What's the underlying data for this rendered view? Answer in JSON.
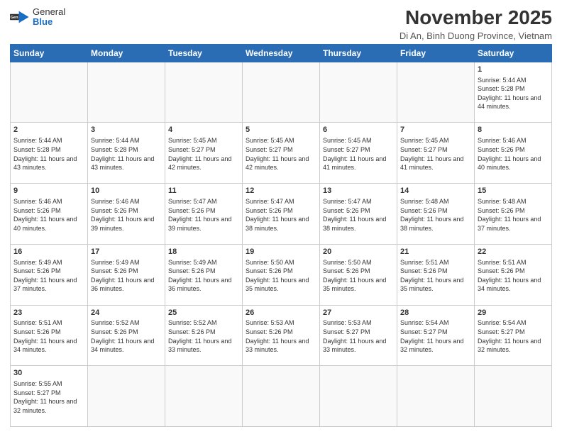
{
  "logo": {
    "general": "General",
    "blue": "Blue"
  },
  "header": {
    "month_title": "November 2025",
    "subtitle": "Di An, Binh Duong Province, Vietnam"
  },
  "weekdays": [
    "Sunday",
    "Monday",
    "Tuesday",
    "Wednesday",
    "Thursday",
    "Friday",
    "Saturday"
  ],
  "weeks": [
    [
      {
        "day": "",
        "content": ""
      },
      {
        "day": "",
        "content": ""
      },
      {
        "day": "",
        "content": ""
      },
      {
        "day": "",
        "content": ""
      },
      {
        "day": "",
        "content": ""
      },
      {
        "day": "",
        "content": ""
      },
      {
        "day": "1",
        "content": "Sunrise: 5:44 AM\nSunset: 5:28 PM\nDaylight: 11 hours and 44 minutes."
      }
    ],
    [
      {
        "day": "2",
        "content": "Sunrise: 5:44 AM\nSunset: 5:28 PM\nDaylight: 11 hours and 43 minutes."
      },
      {
        "day": "3",
        "content": "Sunrise: 5:44 AM\nSunset: 5:28 PM\nDaylight: 11 hours and 43 minutes."
      },
      {
        "day": "4",
        "content": "Sunrise: 5:45 AM\nSunset: 5:27 PM\nDaylight: 11 hours and 42 minutes."
      },
      {
        "day": "5",
        "content": "Sunrise: 5:45 AM\nSunset: 5:27 PM\nDaylight: 11 hours and 42 minutes."
      },
      {
        "day": "6",
        "content": "Sunrise: 5:45 AM\nSunset: 5:27 PM\nDaylight: 11 hours and 41 minutes."
      },
      {
        "day": "7",
        "content": "Sunrise: 5:45 AM\nSunset: 5:27 PM\nDaylight: 11 hours and 41 minutes."
      },
      {
        "day": "8",
        "content": "Sunrise: 5:46 AM\nSunset: 5:26 PM\nDaylight: 11 hours and 40 minutes."
      }
    ],
    [
      {
        "day": "9",
        "content": "Sunrise: 5:46 AM\nSunset: 5:26 PM\nDaylight: 11 hours and 40 minutes."
      },
      {
        "day": "10",
        "content": "Sunrise: 5:46 AM\nSunset: 5:26 PM\nDaylight: 11 hours and 39 minutes."
      },
      {
        "day": "11",
        "content": "Sunrise: 5:47 AM\nSunset: 5:26 PM\nDaylight: 11 hours and 39 minutes."
      },
      {
        "day": "12",
        "content": "Sunrise: 5:47 AM\nSunset: 5:26 PM\nDaylight: 11 hours and 38 minutes."
      },
      {
        "day": "13",
        "content": "Sunrise: 5:47 AM\nSunset: 5:26 PM\nDaylight: 11 hours and 38 minutes."
      },
      {
        "day": "14",
        "content": "Sunrise: 5:48 AM\nSunset: 5:26 PM\nDaylight: 11 hours and 38 minutes."
      },
      {
        "day": "15",
        "content": "Sunrise: 5:48 AM\nSunset: 5:26 PM\nDaylight: 11 hours and 37 minutes."
      }
    ],
    [
      {
        "day": "16",
        "content": "Sunrise: 5:49 AM\nSunset: 5:26 PM\nDaylight: 11 hours and 37 minutes."
      },
      {
        "day": "17",
        "content": "Sunrise: 5:49 AM\nSunset: 5:26 PM\nDaylight: 11 hours and 36 minutes."
      },
      {
        "day": "18",
        "content": "Sunrise: 5:49 AM\nSunset: 5:26 PM\nDaylight: 11 hours and 36 minutes."
      },
      {
        "day": "19",
        "content": "Sunrise: 5:50 AM\nSunset: 5:26 PM\nDaylight: 11 hours and 35 minutes."
      },
      {
        "day": "20",
        "content": "Sunrise: 5:50 AM\nSunset: 5:26 PM\nDaylight: 11 hours and 35 minutes."
      },
      {
        "day": "21",
        "content": "Sunrise: 5:51 AM\nSunset: 5:26 PM\nDaylight: 11 hours and 35 minutes."
      },
      {
        "day": "22",
        "content": "Sunrise: 5:51 AM\nSunset: 5:26 PM\nDaylight: 11 hours and 34 minutes."
      }
    ],
    [
      {
        "day": "23",
        "content": "Sunrise: 5:51 AM\nSunset: 5:26 PM\nDaylight: 11 hours and 34 minutes."
      },
      {
        "day": "24",
        "content": "Sunrise: 5:52 AM\nSunset: 5:26 PM\nDaylight: 11 hours and 34 minutes."
      },
      {
        "day": "25",
        "content": "Sunrise: 5:52 AM\nSunset: 5:26 PM\nDaylight: 11 hours and 33 minutes."
      },
      {
        "day": "26",
        "content": "Sunrise: 5:53 AM\nSunset: 5:26 PM\nDaylight: 11 hours and 33 minutes."
      },
      {
        "day": "27",
        "content": "Sunrise: 5:53 AM\nSunset: 5:27 PM\nDaylight: 11 hours and 33 minutes."
      },
      {
        "day": "28",
        "content": "Sunrise: 5:54 AM\nSunset: 5:27 PM\nDaylight: 11 hours and 32 minutes."
      },
      {
        "day": "29",
        "content": "Sunrise: 5:54 AM\nSunset: 5:27 PM\nDaylight: 11 hours and 32 minutes."
      }
    ],
    [
      {
        "day": "30",
        "content": "Sunrise: 5:55 AM\nSunset: 5:27 PM\nDaylight: 11 hours and 32 minutes."
      },
      {
        "day": "",
        "content": ""
      },
      {
        "day": "",
        "content": ""
      },
      {
        "day": "",
        "content": ""
      },
      {
        "day": "",
        "content": ""
      },
      {
        "day": "",
        "content": ""
      },
      {
        "day": "",
        "content": ""
      }
    ]
  ]
}
